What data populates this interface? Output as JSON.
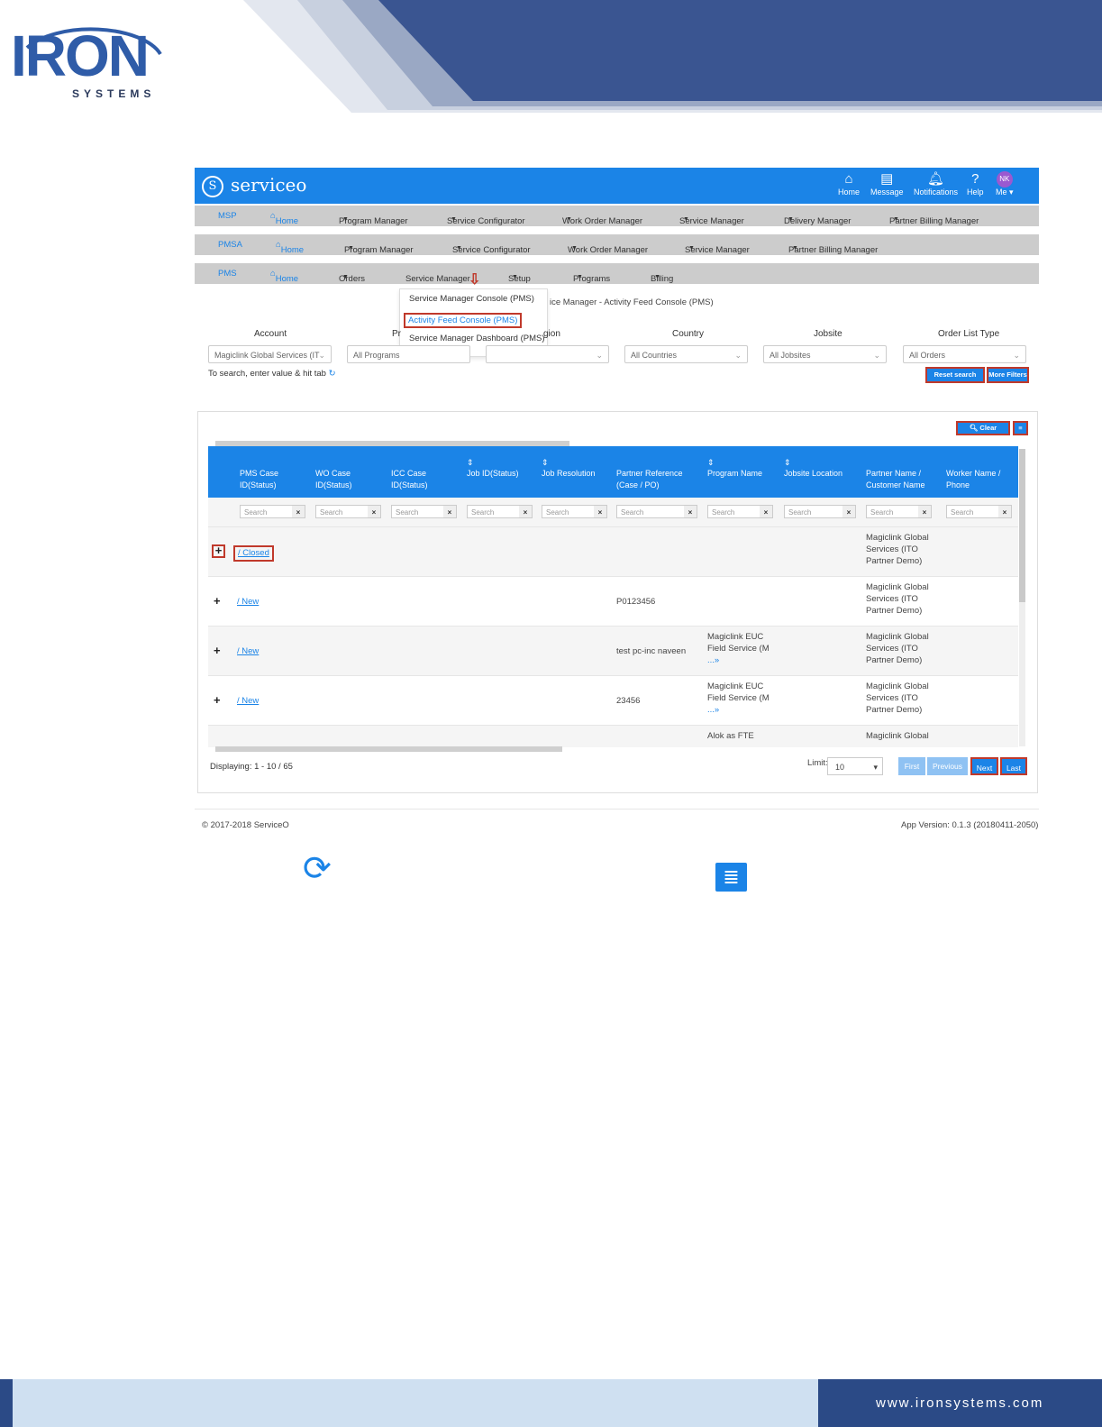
{
  "doc": {
    "logo_main": "IRON",
    "logo_sub": "SYSTEMS",
    "footer_url": "www.ironsystems.com"
  },
  "app": {
    "brand": "serviceo",
    "top_icons": [
      {
        "label": "Home",
        "icon": "home-icon"
      },
      {
        "label": "Message",
        "icon": "message-icon"
      },
      {
        "label": "Notifications",
        "icon": "bell-icon"
      },
      {
        "label": "Help",
        "icon": "help-icon"
      },
      {
        "label": "Me",
        "icon": "avatar-icon",
        "initials": "NK"
      }
    ]
  },
  "menus": {
    "msp": [
      "MSP",
      "Home",
      "Program Manager",
      "Service Configurator",
      "Work Order Manager",
      "Service Manager",
      "Delivery Manager",
      "Partner Billing Manager"
    ],
    "pmsa": [
      "PMSA",
      "Home",
      "Program Manager",
      "Service Configurator",
      "Work Order Manager",
      "Service Manager",
      "Partner Billing Manager"
    ],
    "pms": [
      "PMS",
      "Home",
      "Orders",
      "Service Manager",
      "Setup",
      "Programs",
      "Billing"
    ]
  },
  "dropdown": {
    "items": [
      "Service Manager Console (PMS)",
      "Activity Feed Console (PMS)",
      "Service Manager Dashboard (PMS)"
    ]
  },
  "breadcrumb": "ice Manager - Activity Feed Console (PMS)",
  "filters": {
    "labels": [
      "Account",
      "Pr",
      "gion",
      "Country",
      "Jobsite",
      "Order List Type"
    ],
    "values": [
      "Magiclink Global Services (IT",
      "All Programs",
      "",
      "All Countries",
      "All Jobsites",
      "All Orders"
    ],
    "hint": "To search, enter value & hit tab",
    "reset": "Reset search filter",
    "more": "More Filters"
  },
  "table": {
    "clear_search": "Clear Search",
    "headers": [
      "PMS Case ID(Status)",
      "WO Case ID(Status)",
      "ICC Case ID(Status)",
      "Job ID(Status)",
      "Job Resolution",
      "Partner Reference (Case / PO)",
      "Program Name",
      "Jobsite Location",
      "Partner Name / Customer Name",
      "Worker Name / Phone"
    ],
    "search_placeholder": "Search",
    "rows": [
      {
        "status": "/ Closed",
        "partner_ref": "",
        "program": [
          "",
          "",
          ""
        ],
        "partner": [
          "Magiclink Global",
          "Services (ITO",
          "Partner Demo)"
        ]
      },
      {
        "status": "/ New",
        "partner_ref": "P0123456",
        "program": [
          "",
          "",
          ""
        ],
        "partner": [
          "Magiclink Global",
          "Services (ITO",
          "Partner Demo)"
        ]
      },
      {
        "status": "/ New",
        "partner_ref": "test pc-inc naveen",
        "program": [
          "Magiclink EUC",
          "Field Service (M",
          "...»"
        ],
        "partner": [
          "Magiclink Global",
          "Services (ITO",
          "Partner Demo)"
        ]
      },
      {
        "status": "/ New",
        "partner_ref": "23456",
        "program": [
          "Magiclink EUC",
          "Field Service (M",
          "...»"
        ],
        "partner": [
          "Magiclink Global",
          "Services (ITO",
          "Partner Demo)"
        ]
      },
      {
        "status": "",
        "partner_ref": "",
        "program": [
          "Alok as FTE",
          "",
          ""
        ],
        "partner": [
          "Magiclink Global",
          "",
          ""
        ]
      }
    ],
    "displaying": "Displaying: 1 - 10 / 65",
    "limit_label": "Limit:",
    "limit_value": "10",
    "pager": [
      "First",
      "Previous",
      "Next",
      "Last"
    ]
  },
  "footer": {
    "copyright": "© 2017-2018 ServiceO",
    "version": "App Version: 0.1.3 (20180411-2050)"
  }
}
